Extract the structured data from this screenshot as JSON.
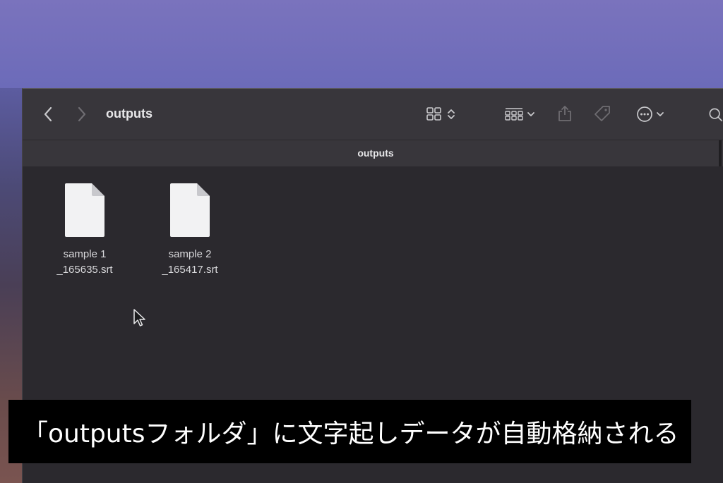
{
  "window": {
    "title": "outputs",
    "path_title": "outputs"
  },
  "toolbar": {
    "icons": [
      "back-icon",
      "forward-icon",
      "grid-view-icon",
      "group-icon",
      "share-icon",
      "tag-icon",
      "more-icon",
      "search-icon"
    ]
  },
  "files": [
    {
      "line1": "sample 1",
      "line2": "_165635.srt"
    },
    {
      "line1": "sample 2",
      "line2": "_165417.srt"
    }
  ],
  "caption": {
    "text": "「outputsフォルダ」に文字起しデータが自動格納される"
  },
  "colors": {
    "window_bg": "#2b292e",
    "toolbar_bg": "#38363b",
    "caption_bg": "#000000",
    "caption_text": "#ffffff"
  }
}
